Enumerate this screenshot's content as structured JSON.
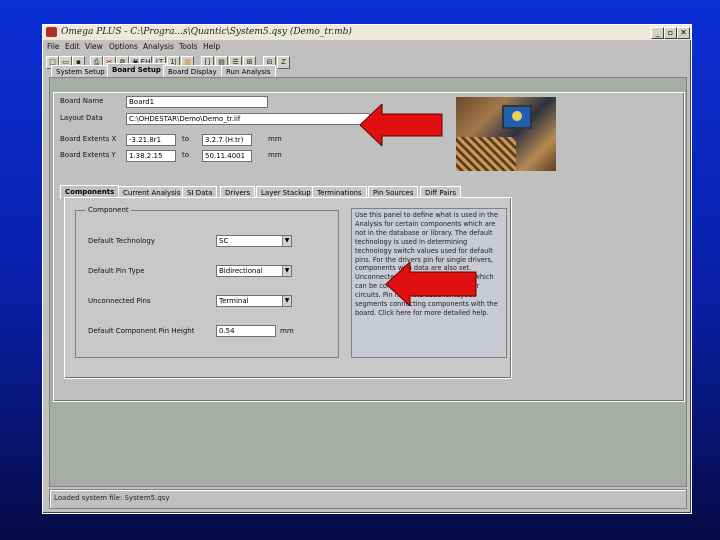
{
  "window": {
    "title": "Omega PLUS - C:\\Progra...s\\Quantic\\System5.qsy (Demo_tr.mb)",
    "controls": [
      "_",
      "▫",
      "✕"
    ]
  },
  "menubar": [
    "File",
    "Edit",
    "View",
    "Options",
    "Analysis",
    "Tools",
    "Help"
  ],
  "toolbar": {
    "icons": [
      "new-file-icon",
      "open-folder-icon",
      "save-icon",
      "print-icon",
      "cut-icon",
      "copy-icon",
      "paste-icon",
      "eh-icon",
      "lt-icon",
      "li-icon",
      "chart-icon",
      "fit-icon",
      "layers-icon",
      "list-icon",
      "zoom-icon",
      "export-icon",
      "text-icon"
    ],
    "glyphs": [
      "□",
      "▭",
      "▪",
      "⎙",
      "✂",
      "⧉",
      "▣",
      "EH",
      "LT",
      "1|",
      "▥",
      "[]",
      "▤",
      "☰",
      "⊞",
      "⊟",
      "Z"
    ]
  },
  "main_tabs": [
    "System Setup",
    "Board Setup",
    "Board Display",
    "Run Analysis"
  ],
  "main_active_tab": "Board Setup",
  "board": {
    "name_label": "Board Name",
    "name_value": "Board1",
    "layout_label": "Layout Data",
    "layout_value": "C:\\OHDESTAR\\Demo\\Demo_tr.lif",
    "extents_x_label": "Board Extents X",
    "extents_x_from": "-3.21.8r1",
    "extents_x_to": "3.2.7.(H.tr)",
    "extents_y_label": "Board Extents Y",
    "extents_y_from": "1.38.2.15",
    "extents_y_to": "50.11.4001",
    "to_label": "to",
    "unit": "mm"
  },
  "sub_tabs": [
    "Components",
    "Current Analysis",
    "SI Data",
    "Drivers",
    "Layer Stackup",
    "Terminations",
    "Pin Sources",
    "Diff Pairs"
  ],
  "sub_active_tab": "Components",
  "component": {
    "group_label": "Component",
    "tech_label": "Default Technology",
    "tech_value": "SC",
    "pin_type_label": "Default Pin Type",
    "pin_type_value": "Bidirectional",
    "unconnected_label": "Unconnected Pins",
    "unconnected_value": "Terminal",
    "pin_height_label": "Default Component Pin Height",
    "pin_height_value": "0.54",
    "pin_height_unit": "mm"
  },
  "help_text": "Use this panel to define what is used in the Analysis for certain components which are not in the database or library. The default technology is used in determining technology switch values used for default pins. For the drivers pin for single drivers, components with data are also set. Unconnected pins are terminal pins which can be connected to ground or power circuits. Pin height is used for layout segments connecting components with the board. Click here for more detailed help.",
  "status": "Loaded system file: System5.qsy"
}
